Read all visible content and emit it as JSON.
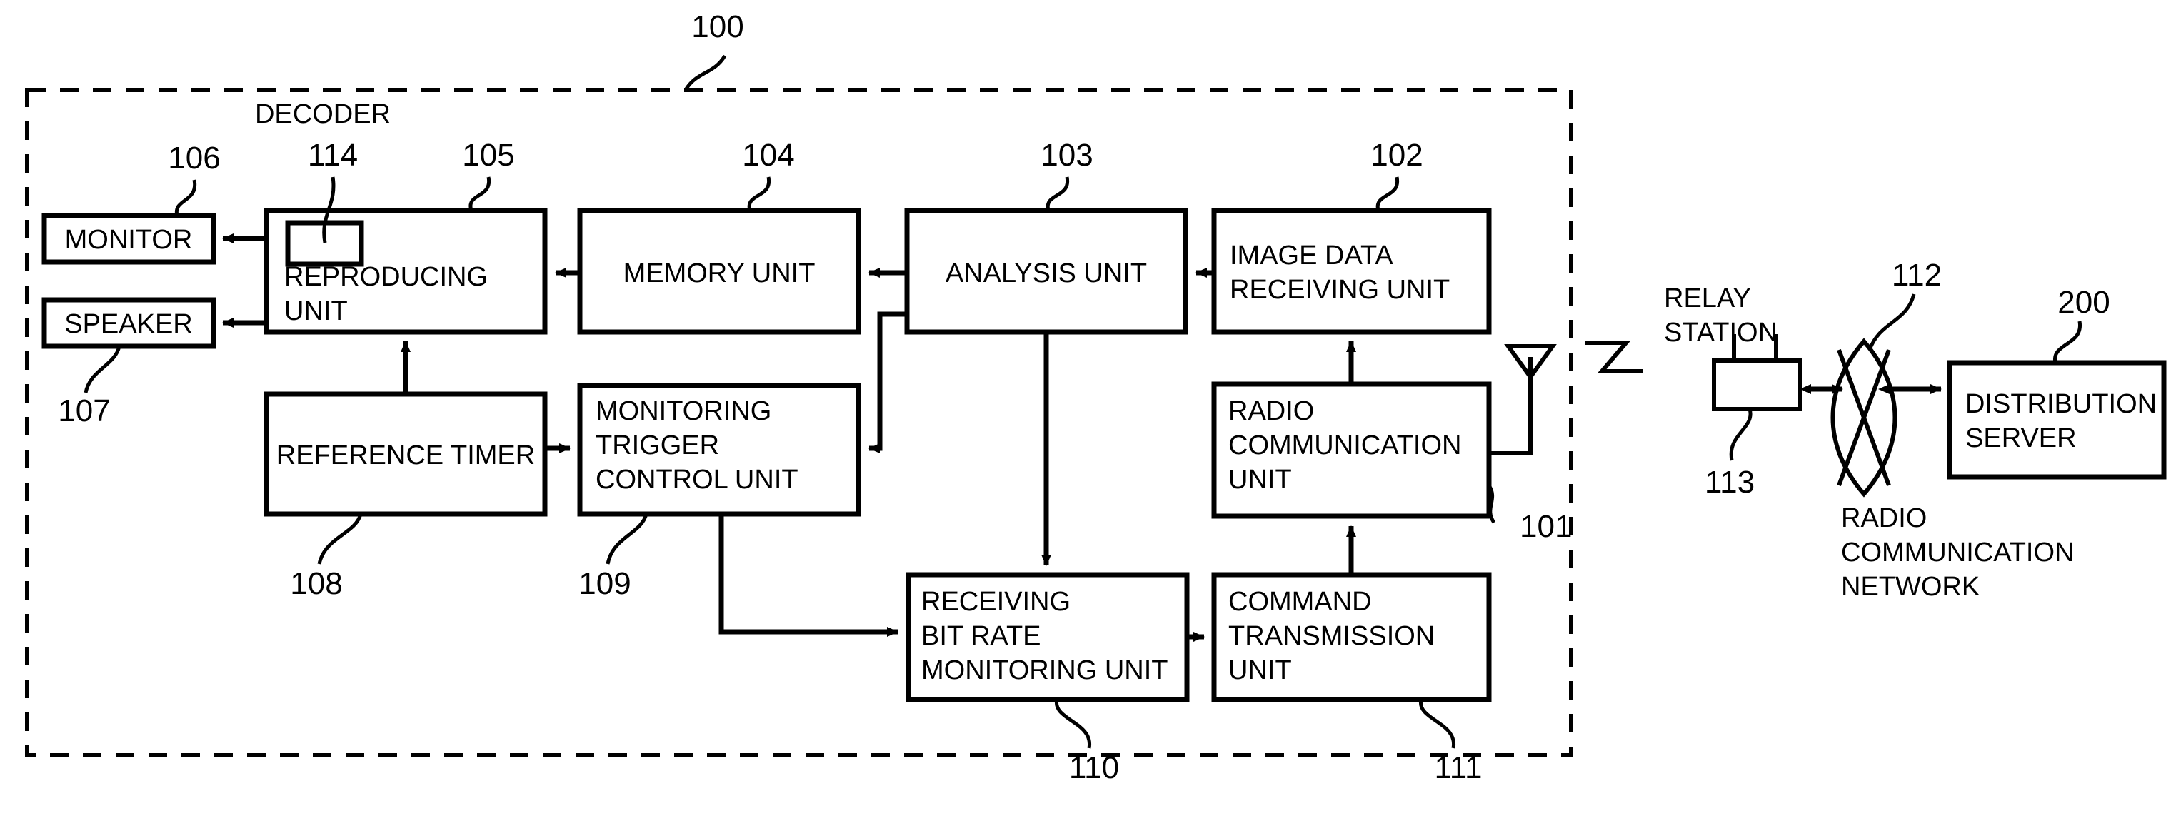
{
  "figure": {
    "type": "patent-block-diagram",
    "system_ref": "100",
    "decoder_label": "DECODER",
    "terminal_boundary": "dashed-enclosure"
  },
  "blocks": {
    "monitor": {
      "label": "MONITOR",
      "ref": "106"
    },
    "speaker": {
      "label": "SPEAKER",
      "ref": "107"
    },
    "reproducing": {
      "line1": "REPRODUCING",
      "line2": "UNIT",
      "ref": "105",
      "inner_ref": "114"
    },
    "memory": {
      "label": "MEMORY UNIT",
      "ref": "104"
    },
    "analysis": {
      "label": "ANALYSIS UNIT",
      "ref": "103"
    },
    "image_data_recv": {
      "line1": "IMAGE DATA",
      "line2": "RECEIVING UNIT",
      "ref": "102"
    },
    "reference_timer": {
      "label": "REFERENCE TIMER",
      "ref": "108"
    },
    "monitor_trigger": {
      "line1": "MONITORING",
      "line2": "TRIGGER",
      "line3": "CONTROL UNIT",
      "ref": "109"
    },
    "radio_comm": {
      "line1": "RADIO",
      "line2": "COMMUNICATION",
      "line3": "UNIT",
      "ref": "101"
    },
    "bitrate_monitor": {
      "line1": "RECEIVING",
      "line2": "BIT RATE",
      "line3": "MONITORING UNIT",
      "ref": "110"
    },
    "command_tx": {
      "line1": "COMMAND",
      "line2": "TRANSMISSION",
      "line3": "UNIT",
      "ref": "111"
    },
    "relay_station": {
      "line1": "RELAY",
      "line2": "STATION",
      "ref": "113"
    },
    "radio_network": {
      "line1": "RADIO",
      "line2": "COMMUNICATION",
      "line3": "NETWORK",
      "ref": "112"
    },
    "distribution_server": {
      "line1": "DISTRIBUTION",
      "line2": "SERVER",
      "ref": "200"
    }
  },
  "icons": {
    "antenna": "antenna-icon",
    "wireless_link": "wireless-zigzag-icon",
    "network_cloud": "network-lens-icon"
  },
  "colors": {
    "line": "#000000",
    "background": "#ffffff"
  }
}
